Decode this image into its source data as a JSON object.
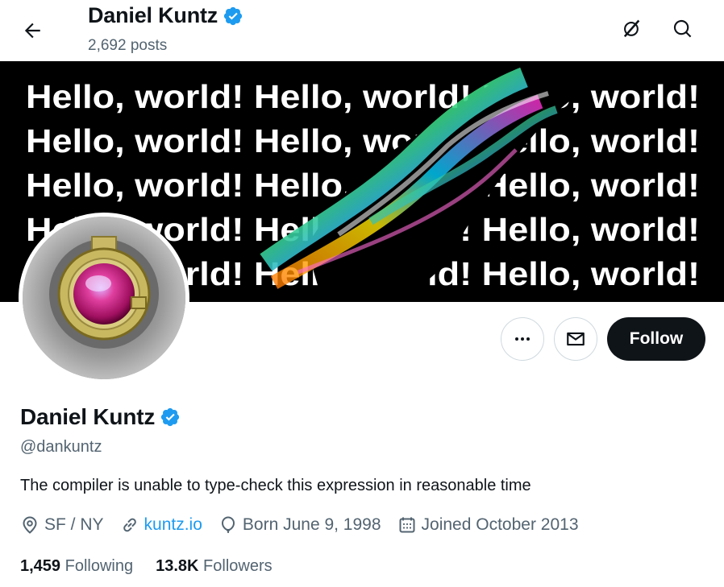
{
  "header": {
    "name": "Daniel Kuntz",
    "posts": "2,692 posts"
  },
  "banner": {
    "rows": [
      "Hello, world! Hello, world! Hello, world!",
      "Hello, world! Hello, world! Hello, world!",
      "Hello, world! Hello, world! Hello, world!",
      "Hello, world! Hello, world! Hello, world!",
      "Hello, world! Hello, world! Hello, world!"
    ]
  },
  "profile": {
    "display_name": "Daniel Kuntz",
    "handle": "@dankuntz",
    "bio": "The compiler is unable to type-check this expression in reasonable time",
    "location": "SF / NY",
    "website": "kuntz.io",
    "birthday": "Born June 9, 1998",
    "joined": "Joined October 2013"
  },
  "actions": {
    "follow_label": "Follow"
  },
  "stats": {
    "following_count": "1,459",
    "following_label": "Following",
    "followers_count": "13.8K",
    "followers_label": "Followers"
  },
  "colors": {
    "verified": "#1d9bf0",
    "link": "#1d9bf0",
    "muted": "#536471",
    "text": "#0f1419"
  },
  "icons": [
    "back-arrow-icon",
    "grok-icon",
    "search-icon",
    "verified-badge-icon",
    "more-icon",
    "message-icon",
    "location-icon",
    "link-icon",
    "balloon-icon",
    "calendar-icon"
  ]
}
